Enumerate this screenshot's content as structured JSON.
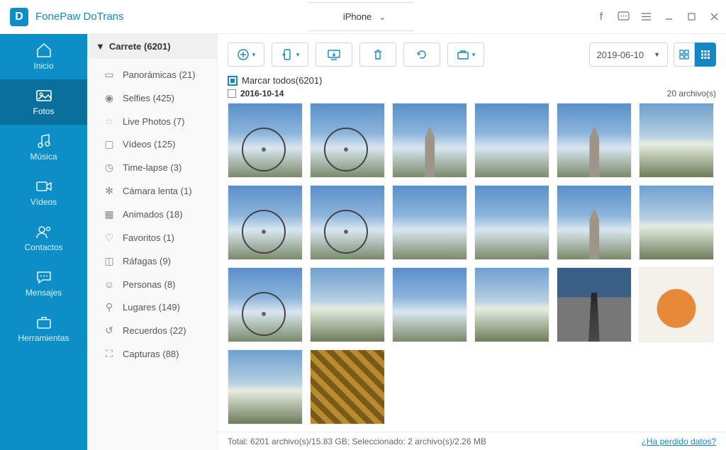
{
  "app": {
    "name": "FonePaw DoTrans",
    "device": "iPhone"
  },
  "nav": {
    "home": "Inicio",
    "photos": "Fotos",
    "music": "Música",
    "videos": "Vídeos",
    "contacts": "Contactos",
    "messages": "Mensajes",
    "tools": "Herramientas"
  },
  "subnav": {
    "header": "Carrete (6201)",
    "items": [
      {
        "label": "Panorámicas (21)"
      },
      {
        "label": "Selfies (425)"
      },
      {
        "label": "Live Photos (7)"
      },
      {
        "label": "Vídeos (125)"
      },
      {
        "label": "Time-lapse (3)"
      },
      {
        "label": "Cámara lenta (1)"
      },
      {
        "label": "Animados (18)"
      },
      {
        "label": "Favoritos (1)"
      },
      {
        "label": "Ráfagas (9)"
      },
      {
        "label": "Personas (8)"
      },
      {
        "label": "Lugares (149)"
      },
      {
        "label": "Recuerdos (22)"
      },
      {
        "label": "Capturas (88)"
      }
    ]
  },
  "toolbar": {
    "date": "2019-06-10"
  },
  "content": {
    "select_all": "Marcar todos(6201)",
    "group_date": "2016-10-14",
    "group_count": "20 archivo(s)"
  },
  "status": {
    "summary": "Total: 6201 archivo(s)/15.83 GB; Seleccionado: 2 archivo(s)/2.26 MB",
    "lost_link": "¿Ha perdido datos?"
  }
}
